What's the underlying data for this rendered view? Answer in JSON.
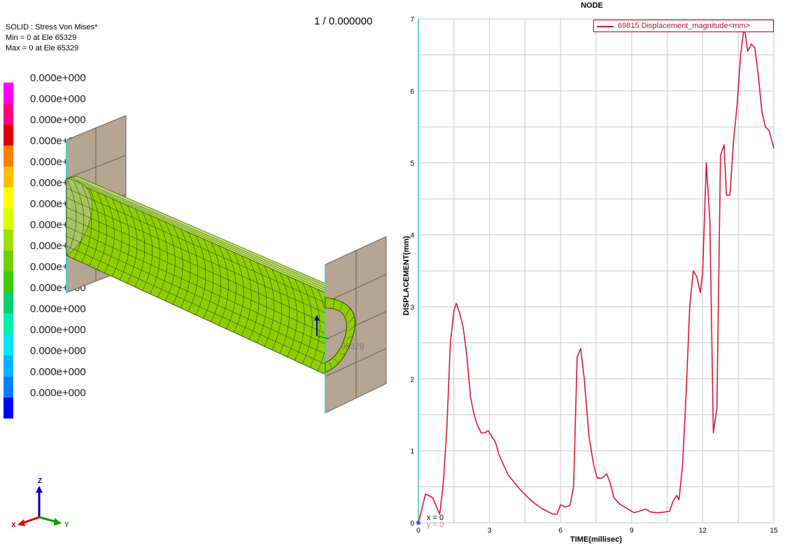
{
  "fea": {
    "result_title": "SOLID : Stress Von Mises*",
    "min_text": "Min = 0 at Ele 65329",
    "max_text": "Max = 0 at Ele 65329",
    "frame": "1 / 0.000000",
    "node_tag": "65329",
    "legend": {
      "colors": [
        "#ff00ff",
        "#ff007f",
        "#e00000",
        "#ff7f00",
        "#ffbf00",
        "#ffff00",
        "#d8ff00",
        "#a0e000",
        "#70d000",
        "#40c800",
        "#00d070",
        "#00f0b0",
        "#00e8ff",
        "#00b8ff",
        "#0080ff",
        "#0000ff"
      ],
      "labels": [
        "0.000e+000",
        "0.000e+000",
        "0.000e+000",
        "0.000e+000",
        "0.000e+000",
        "0.000e+000",
        "0.000e+000",
        "0.000e+000",
        "0.000e+000",
        "0.000e+000",
        "0.000e+000",
        "0.000e+000",
        "0.000e+000",
        "0.000e+000",
        "0.000e+000",
        "0.000e+000"
      ]
    },
    "model_colors": {
      "tube": "#8fcf00",
      "tube_dark": "#6aa000",
      "plate": "#b5a592",
      "edge_highlight": "#3fd0d0"
    },
    "triad": {
      "x_label": "X",
      "y_label": "Y",
      "z_label": "Z",
      "x_color": "#e00000",
      "y_color": "#00a000",
      "z_color": "#0000c8"
    }
  },
  "chart_data": {
    "type": "line",
    "title": "NODE",
    "xlabel": "TIME(millisec)",
    "ylabel": "DISPLACEMENT(mm)",
    "xlim": [
      0,
      15
    ],
    "ylim": [
      0,
      7
    ],
    "xticks": [
      0,
      3,
      6,
      9,
      12,
      15
    ],
    "yticks": [
      0,
      1,
      2,
      3,
      4,
      5,
      6,
      7
    ],
    "grid": true,
    "legend_placement": "top-right",
    "cursor_readout": [
      "x = 0",
      "y = 0"
    ],
    "series": [
      {
        "name": "69815 Displacement_magnitude<mm>",
        "color": "#d8163c",
        "x": [
          0,
          0.3,
          0.6,
          0.9,
          1.05,
          1.2,
          1.35,
          1.5,
          1.6,
          1.75,
          1.9,
          2.05,
          2.2,
          2.35,
          2.5,
          2.65,
          2.8,
          2.95,
          3.1,
          3.25,
          3.4,
          3.6,
          3.8,
          4.0,
          4.3,
          4.6,
          4.9,
          5.2,
          5.5,
          5.7,
          5.85,
          6.0,
          6.2,
          6.4,
          6.55,
          6.7,
          6.85,
          7.0,
          7.2,
          7.4,
          7.55,
          7.75,
          7.95,
          8.1,
          8.25,
          8.5,
          8.8,
          9.1,
          9.4,
          9.6,
          9.8,
          10.1,
          10.4,
          10.6,
          10.75,
          10.9,
          11.0,
          11.15,
          11.3,
          11.45,
          11.6,
          11.75,
          11.9,
          12.0,
          12.15,
          12.3,
          12.45,
          12.6,
          12.75,
          12.9,
          13.0,
          13.15,
          13.3,
          13.45,
          13.6,
          13.75,
          13.9,
          14.05,
          14.2,
          14.35,
          14.5,
          14.65,
          14.8,
          15.0
        ],
        "y": [
          0.0,
          0.4,
          0.35,
          0.12,
          0.55,
          1.3,
          2.5,
          2.95,
          3.05,
          2.9,
          2.7,
          2.3,
          1.75,
          1.5,
          1.35,
          1.25,
          1.25,
          1.28,
          1.2,
          1.12,
          0.95,
          0.8,
          0.66,
          0.58,
          0.46,
          0.36,
          0.27,
          0.2,
          0.15,
          0.12,
          0.12,
          0.25,
          0.22,
          0.24,
          0.5,
          2.3,
          2.42,
          2.0,
          1.2,
          0.8,
          0.62,
          0.62,
          0.68,
          0.55,
          0.35,
          0.26,
          0.2,
          0.14,
          0.17,
          0.19,
          0.15,
          0.14,
          0.15,
          0.16,
          0.3,
          0.38,
          0.32,
          0.8,
          1.8,
          3.0,
          3.5,
          3.42,
          3.2,
          3.5,
          5.0,
          4.2,
          1.25,
          1.6,
          5.1,
          5.25,
          4.55,
          4.55,
          5.3,
          5.8,
          6.5,
          6.9,
          6.55,
          6.65,
          6.6,
          6.2,
          5.7,
          5.5,
          5.45,
          5.2
        ]
      }
    ]
  }
}
